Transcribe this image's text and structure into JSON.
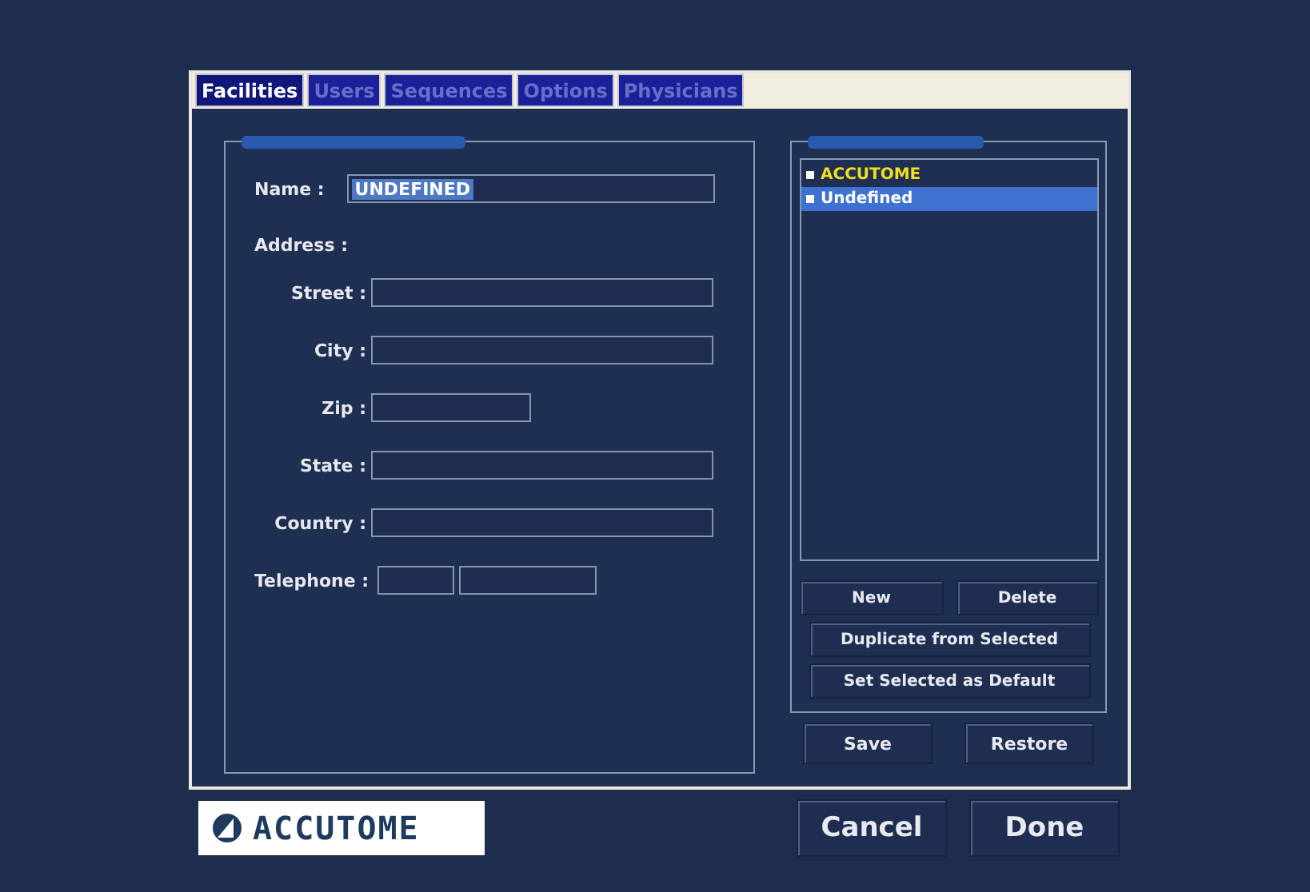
{
  "tabs": [
    {
      "label": "Facilities",
      "selected": true
    },
    {
      "label": "Users",
      "selected": false
    },
    {
      "label": "Sequences",
      "selected": false
    },
    {
      "label": "Options",
      "selected": false
    },
    {
      "label": "Physicians",
      "selected": false
    }
  ],
  "facility": {
    "name_label": "Name :",
    "name_value": "UNDEFINED",
    "name_highlighted": true,
    "address_label": "Address :",
    "fields": [
      {
        "label": "Street :",
        "kind": "long"
      },
      {
        "label": "City :",
        "kind": "long"
      },
      {
        "label": "Zip :",
        "kind": "short"
      },
      {
        "label": "State :",
        "kind": "long"
      },
      {
        "label": "Country :",
        "kind": "long"
      }
    ],
    "telephone_label": "Telephone :"
  },
  "facilities_list": [
    {
      "label": "ACCUTOME",
      "default": true,
      "selected": false
    },
    {
      "label": "Undefined",
      "default": false,
      "selected": true
    }
  ],
  "list_buttons": [
    [
      "New",
      "Delete"
    ],
    [
      "Duplicate from Selected"
    ],
    [
      "Set Selected as Default"
    ]
  ],
  "panel_buttons": [
    "Save",
    "Restore"
  ],
  "logo": "ACCUTOME",
  "footer_buttons": [
    "Cancel",
    "Done"
  ]
}
